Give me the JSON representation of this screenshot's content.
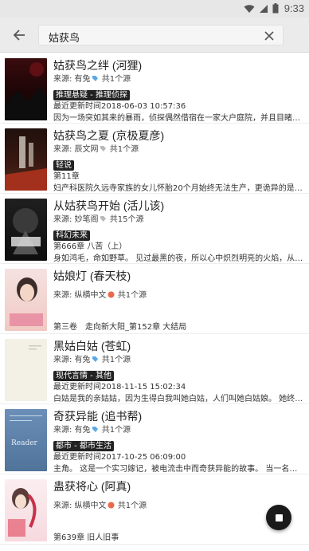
{
  "status": {
    "time": "9:33"
  },
  "search": {
    "query": "姑获鸟"
  },
  "results": [
    {
      "title": "姑获鸟之绊 (河狸)",
      "source_prefix": "来源: 有兔",
      "source_suffix": "共1个源",
      "category": "推理悬疑 - 推理侦探",
      "line1": "最近更新时间2018-06-03 10:57:36",
      "line2": "因为一场突如其来的暴雨，侦探偶然借宿在一家大户庭院，并且目睹了…",
      "cover_text": "姑获鸟之绊"
    },
    {
      "title": "姑获鸟之夏 (京极夏彦)",
      "source_prefix": "来源: 辰文网",
      "source_suffix": "共1个源",
      "category": "轻说",
      "line1": "第11章",
      "line2": "妇产科医院久远寺家族的女儿怀胎20个月始终无法生产，更诡异的是，…",
      "cover_text": "姑获鸟之夏"
    },
    {
      "title": "从姑获鸟开始 (活儿该)",
      "source_prefix": "来源: 妙笔阁",
      "source_suffix": "共15个源",
      "category": "科幻未来",
      "line1": "第666章 八苦（上）",
      "line2": "身如鸿毛，命如野草。 见过最黑的夜，所以心中炽烈明亮的火焰，从不…",
      "cover_text": "从姑获鸟开始"
    },
    {
      "title": "姑娘灯 (春天枝)",
      "source_prefix": "来源: 纵横中文",
      "source_suffix": "共1个源",
      "category": "",
      "line1": "",
      "line2": "第三卷　走向新大阳_第152章 大结局",
      "cover_text": "姑娘灯"
    },
    {
      "title": "黑姑白姑 (苍虹)",
      "source_prefix": "来源: 有兔",
      "source_suffix": "共1个源",
      "category": "现代言情 - 其他",
      "line1": "最近更新时间2018-11-15 15:02:34",
      "line2": "白姑是我的亲姑姑，因为生得白我叫她白姑，人们叫她白姑娘。 她终细…",
      "cover_text": ""
    },
    {
      "title": "奇获异能 (追书帮)",
      "source_prefix": "来源: 有兔",
      "source_suffix": "共1个源",
      "category": "都市 - 都市生活",
      "line1": "最近更新时间2017-10-25 06:09:00",
      "line2": "主角。 这是一个实习嫁记，被电流击中而奇获异能的故事。 当一名陌生…",
      "cover_text": "Reader"
    },
    {
      "title": "蛊获将心 (阿真)",
      "source_prefix": "来源: 纵横中文",
      "source_suffix": "共1个源",
      "category": "",
      "line1": "",
      "line2": "第639章 旧人旧事",
      "cover_text": "蛊获将心"
    }
  ],
  "colors": {
    "toolbar": "#ebebeb",
    "statusbar": "#e7e7e7",
    "tag": "#222222",
    "fab": "#1a1a1a"
  },
  "icons": {
    "back": "arrow-back-icon",
    "clear": "close-icon",
    "fab": "stop-icon",
    "wifi": "wifi-icon",
    "signal": "signal-icon",
    "battery": "battery-icon"
  }
}
